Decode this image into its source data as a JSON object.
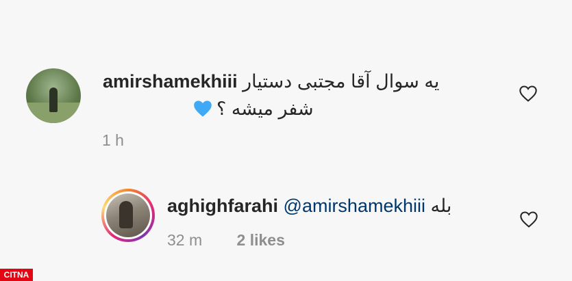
{
  "comments": [
    {
      "username": "amirshamekhiii",
      "text_line1": "یه سوال آقا مجتبی دستیار",
      "text_line2": "شفر میشه ؟",
      "emoji": "blue-heart-icon",
      "time": "1 h"
    }
  ],
  "reply": {
    "username": "aghighfarahi",
    "mention": "@amirshamekhiii",
    "text": "بله",
    "time": "32 m",
    "likes": "2 likes"
  },
  "watermark": "CITNA",
  "colors": {
    "text": "#262626",
    "meta": "#8e8e8e",
    "mention": "#00376b",
    "blue_heart": "#3fa9f5",
    "logo": "#e30613"
  }
}
